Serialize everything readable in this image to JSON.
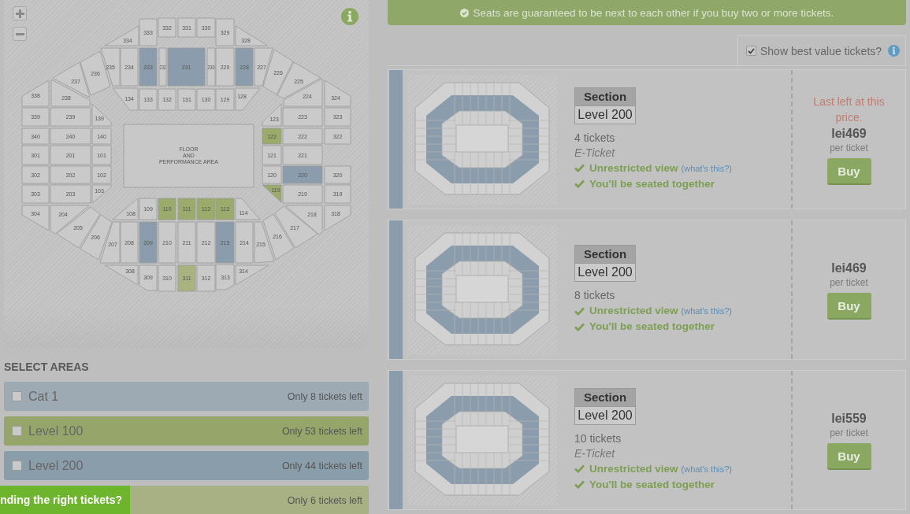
{
  "seat_map": {
    "floor_label": [
      "FLOOR",
      "AND",
      "PERFORMANCE AREA"
    ],
    "sections": [
      {
        "label": "334"
      },
      {
        "label": "333"
      },
      {
        "label": "332"
      },
      {
        "label": "331"
      },
      {
        "label": "330"
      },
      {
        "label": "329"
      },
      {
        "label": "328"
      },
      {
        "label": "237"
      },
      {
        "label": "236"
      },
      {
        "label": "235"
      },
      {
        "label": "234"
      },
      {
        "label": "233",
        "color": "#8b9dac"
      },
      {
        "label": "232"
      },
      {
        "label": "231",
        "color": "#8b9dac"
      },
      {
        "label": "230"
      },
      {
        "label": "229"
      },
      {
        "label": "228",
        "color": "#8b9dac"
      },
      {
        "label": "227"
      },
      {
        "label": "226"
      },
      {
        "label": "225"
      },
      {
        "label": "338"
      },
      {
        "label": "238"
      },
      {
        "label": "134"
      },
      {
        "label": "133"
      },
      {
        "label": "132"
      },
      {
        "label": "131"
      },
      {
        "label": "130"
      },
      {
        "label": "129"
      },
      {
        "label": "128"
      },
      {
        "label": "224"
      },
      {
        "label": "324"
      },
      {
        "label": "339"
      },
      {
        "label": "239"
      },
      {
        "label": "139"
      },
      {
        "label": "123"
      },
      {
        "label": "223"
      },
      {
        "label": "323"
      },
      {
        "label": "340"
      },
      {
        "label": "240"
      },
      {
        "label": "140"
      },
      {
        "label": "122",
        "color": "#9aab6b"
      },
      {
        "label": "222"
      },
      {
        "label": "322"
      },
      {
        "label": "301"
      },
      {
        "label": "201"
      },
      {
        "label": "101"
      },
      {
        "label": "121"
      },
      {
        "label": "221"
      },
      {
        "label": "302"
      },
      {
        "label": "202"
      },
      {
        "label": "102"
      },
      {
        "label": "120"
      },
      {
        "label": "220",
        "color": "#8b9dac"
      },
      {
        "label": "320"
      },
      {
        "label": "303"
      },
      {
        "label": "203"
      },
      {
        "label": "103"
      },
      {
        "label": "119",
        "color": "#9aab6b"
      },
      {
        "label": "219"
      },
      {
        "label": "319"
      },
      {
        "label": "304"
      },
      {
        "label": "204"
      },
      {
        "label": "205"
      },
      {
        "label": "206"
      },
      {
        "label": "207"
      },
      {
        "label": "108"
      },
      {
        "label": "208"
      },
      {
        "label": "109"
      },
      {
        "label": "209",
        "color": "#8b9dac"
      },
      {
        "label": "110",
        "color": "#9aab6b"
      },
      {
        "label": "210"
      },
      {
        "label": "111",
        "color": "#9aab6b"
      },
      {
        "label": "211"
      },
      {
        "label": "112",
        "color": "#9aab6b"
      },
      {
        "label": "212"
      },
      {
        "label": "113",
        "color": "#9aab6b"
      },
      {
        "label": "213",
        "color": "#8b9dac"
      },
      {
        "label": "114"
      },
      {
        "label": "214"
      },
      {
        "label": "215"
      },
      {
        "label": "216"
      },
      {
        "label": "217"
      },
      {
        "label": "218"
      },
      {
        "label": "318"
      },
      {
        "label": "308"
      },
      {
        "label": "309"
      },
      {
        "label": "310"
      },
      {
        "label": "311",
        "color": "#a9b380"
      },
      {
        "label": "312"
      },
      {
        "label": "313"
      },
      {
        "label": "314"
      }
    ]
  },
  "select_areas": {
    "title": "SELECT AREAS",
    "areas": [
      {
        "label": "Cat 1",
        "checked": false,
        "availability": "Only 8 tickets left",
        "color": "#9eaab3"
      },
      {
        "label": "Level 100",
        "checked": false,
        "availability": "Only 53 tickets left",
        "color": "#96a66a"
      },
      {
        "label": "Level 200",
        "checked": false,
        "availability": "Only 44 tickets left",
        "color": "#8a9dab"
      },
      {
        "availability": "Only 6 tickets left",
        "color": "#a8b184"
      }
    ]
  },
  "help_tab": {
    "label": "nding the right tickets?"
  },
  "banner": {
    "text": "Seats are guaranteed to be next to each other if you buy two or more tickets."
  },
  "best_value": {
    "label": "Show best value tickets?",
    "checked": true
  },
  "tickets": [
    {
      "color": "#8b9dac",
      "section_header": "Section",
      "section": "Level 200",
      "quantity": "4 tickets",
      "delivery": "E-Ticket",
      "features": [
        {
          "text": "Unrestricted view",
          "link": "(what's this?)"
        },
        {
          "text": "You'll be seated together"
        }
      ],
      "notice": "Last left at this price.",
      "price": "lei469",
      "price_unit": "per ticket",
      "button": "Buy"
    },
    {
      "color": "#8b9dac",
      "section_header": "Section",
      "section": "Level 200",
      "quantity": "8 tickets",
      "features": [
        {
          "text": "Unrestricted view",
          "link": "(what's this?)"
        },
        {
          "text": "You'll be seated together"
        }
      ],
      "price": "lei469",
      "price_unit": "per ticket",
      "button": "Buy"
    },
    {
      "color": "#8b9dac",
      "section_header": "Section",
      "section": "Level 200",
      "quantity": "10 tickets",
      "delivery": "E-Ticket",
      "features": [
        {
          "text": "Unrestricted view",
          "link": "(what's this?)"
        },
        {
          "text": "You'll be seated together"
        }
      ],
      "price": "lei559",
      "price_unit": "per ticket",
      "button": "Buy"
    }
  ]
}
